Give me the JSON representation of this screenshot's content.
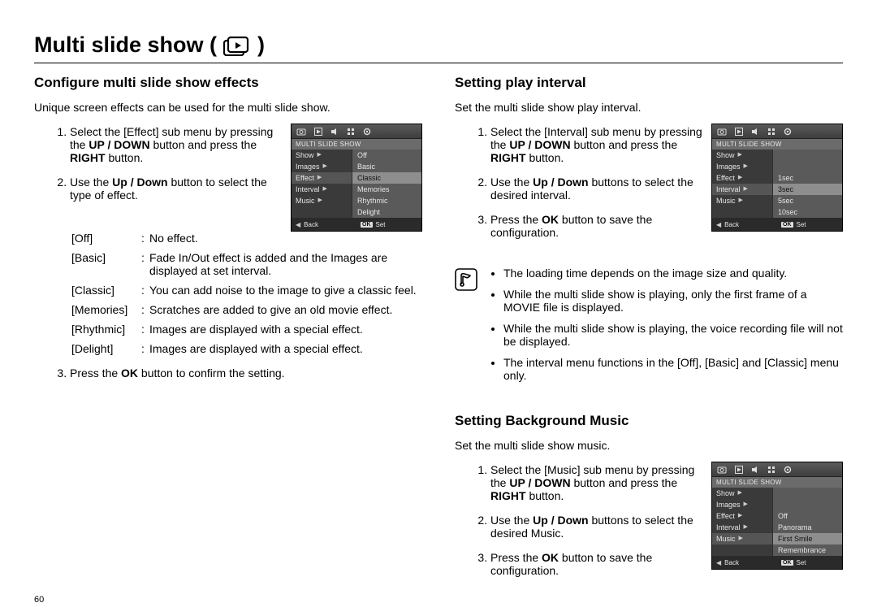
{
  "page_number": "60",
  "title": "Multi slide show (",
  "title_close": ")",
  "left": {
    "heading": "Configure multi slide show effects",
    "intro": "Unique screen effects can be used for the multi slide show.",
    "steps": {
      "s1a": "Select the [Effect] sub menu by pressing the ",
      "s1b": "UP / DOWN",
      "s1c": " button and press the ",
      "s1d": "RIGHT",
      "s1e": " button.",
      "s2a": "Use the ",
      "s2b": "Up / Down",
      "s2c": " button to select the type of effect.",
      "s3a": "Press the ",
      "s3b": "OK",
      "s3c": " button to confirm the setting."
    },
    "defs": [
      {
        "term": "[Off]",
        "desc": "No effect."
      },
      {
        "term": "[Basic]",
        "desc": "Fade In/Out effect is added and the Images are displayed at set interval."
      },
      {
        "term": "[Classic]",
        "desc": "You can add noise to the image to give a classic feel."
      },
      {
        "term": "[Memories]",
        "desc": "Scratches are added to give an old movie effect."
      },
      {
        "term": "[Rhythmic]",
        "desc": "Images are displayed with a special effect."
      },
      {
        "term": "[Delight]",
        "desc": "Images are displayed with a special effect."
      }
    ],
    "lcd": {
      "title": "MULTI SLIDE SHOW",
      "rows": [
        {
          "left": "Show",
          "right": "Off",
          "hi": false
        },
        {
          "left": "Images",
          "right": "Basic",
          "hi": false
        },
        {
          "left": "Effect",
          "right": "Classic",
          "hi": true
        },
        {
          "left": "Interval",
          "right": "Memories",
          "hi": false
        },
        {
          "left": "Music",
          "right": "Rhythmic",
          "hi": false
        },
        {
          "left": "",
          "right": "Delight",
          "hi": false
        }
      ],
      "back": "Back",
      "ok": "OK",
      "set": "Set"
    }
  },
  "right_a": {
    "heading": "Setting play interval",
    "intro": "Set the multi slide show play interval.",
    "steps": {
      "s1a": "Select the [Interval] sub menu by pressing the ",
      "s1b": "UP / DOWN",
      "s1c": " button and press the ",
      "s1d": "RIGHT",
      "s1e": " button.",
      "s2a": "Use the ",
      "s2b": "Up / Down",
      "s2c": " buttons to select the desired interval.",
      "s3a": "Press the ",
      "s3b": "OK",
      "s3c": " button to save the configuration."
    },
    "lcd": {
      "title": "MULTI SLIDE SHOW",
      "rows": [
        {
          "left": "Show",
          "right": "",
          "hi": false
        },
        {
          "left": "Images",
          "right": "",
          "hi": false
        },
        {
          "left": "Effect",
          "right": "1sec",
          "hi": false
        },
        {
          "left": "Interval",
          "right": "3sec",
          "hi": true
        },
        {
          "left": "Music",
          "right": "5sec",
          "hi": false
        },
        {
          "left": "",
          "right": "10sec",
          "hi": false
        }
      ],
      "back": "Back",
      "ok": "OK",
      "set": "Set"
    },
    "notes": [
      "The loading time depends on the image size and quality.",
      "While the multi slide show is playing, only the first frame of a MOVIE file is displayed.",
      "While the multi slide show is playing, the voice recording file will not be displayed.",
      "The interval menu functions in the [Off], [Basic] and [Classic] menu only."
    ]
  },
  "right_b": {
    "heading": "Setting Background Music",
    "intro": "Set the multi slide show music.",
    "steps": {
      "s1a": "Select the [Music] sub menu by pressing the ",
      "s1b": "UP / DOWN",
      "s1c": " button and press the ",
      "s1d": "RIGHT",
      "s1e": " button.",
      "s2a": "Use the ",
      "s2b": "Up / Down",
      "s2c": " buttons to select the desired Music.",
      "s3a": "Press the ",
      "s3b": "OK",
      "s3c": " button to save the configuration."
    },
    "lcd": {
      "title": "MULTI SLIDE SHOW",
      "rows": [
        {
          "left": "Show",
          "right": "",
          "hi": false
        },
        {
          "left": "Images",
          "right": "",
          "hi": false
        },
        {
          "left": "Effect",
          "right": "Off",
          "hi": false
        },
        {
          "left": "Interval",
          "right": "Panorama",
          "hi": false
        },
        {
          "left": "Music",
          "right": "First Smile",
          "hi": true
        },
        {
          "left": "",
          "right": "Remembrance",
          "hi": false
        }
      ],
      "back": "Back",
      "ok": "OK",
      "set": "Set"
    }
  }
}
